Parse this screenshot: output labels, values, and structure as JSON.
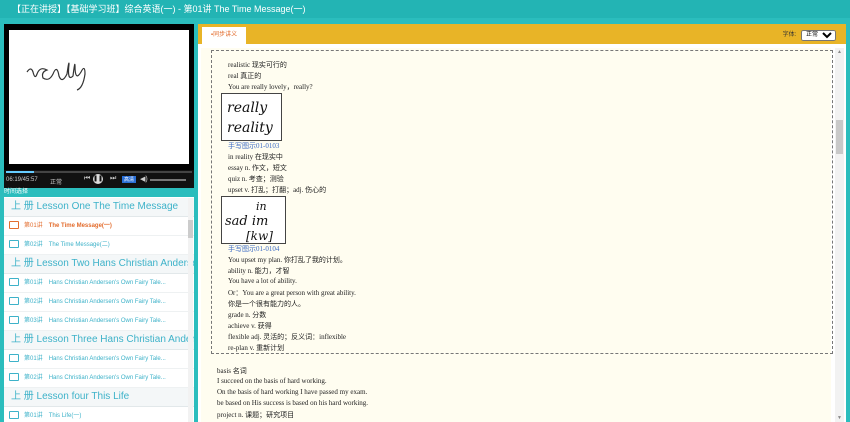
{
  "window": {
    "title": "【正在讲授】【基础学习班】综合英语(一) - 第01讲   The Time Message(一)"
  },
  "player": {
    "handwriting": "really",
    "time": "06:19/45:57",
    "rate": "正常",
    "hd_label": "高清",
    "time_select": "时间选择"
  },
  "lessons": [
    {
      "kind": "head",
      "label": "上   册 Lesson One The Time Message"
    },
    {
      "kind": "item",
      "num": "第01讲",
      "name": "The Time Message(一)",
      "active": true
    },
    {
      "kind": "item",
      "num": "第02讲",
      "name": "The Time Message(二)"
    },
    {
      "kind": "head",
      "label": "上   册 Lesson Two    Hans Christian Andersen"
    },
    {
      "kind": "item",
      "num": "第01讲",
      "name": "Hans Christian Andersen's Own Fairy Tale..."
    },
    {
      "kind": "item",
      "num": "第02讲",
      "name": "Hans Christian Andersen's Own Fairy Tale..."
    },
    {
      "kind": "item",
      "num": "第03讲",
      "name": "Hans Christian Andersen's Own Fairy Tale..."
    },
    {
      "kind": "head",
      "label": "上   册 Lesson Three    Hans Christian Andersen"
    },
    {
      "kind": "item",
      "num": "第01讲",
      "name": "Hans Christian Andersen's Own Fairy Tale..."
    },
    {
      "kind": "item",
      "num": "第02讲",
      "name": "Hans Christian Andersen's Own Fairy Tale..."
    },
    {
      "kind": "head",
      "label": "上   册 Lesson four    This Life"
    },
    {
      "kind": "item",
      "num": "第01讲",
      "name": "This Life(一)"
    }
  ],
  "notes": {
    "tab_label": "同步讲义",
    "font_label": "字体:",
    "font_value": "正常",
    "box_lines_a": [
      "realistic 现实可行的",
      "real 真正的",
      "You are really lovely，really?"
    ],
    "caption1": "手写图示01-0103",
    "box_lines_b": [
      "in reality 在现实中",
      "essay n. 作文，短文",
      "quiz n. 考查；测验",
      "upset v. 打乱；打翻；adj. 伤心的"
    ],
    "caption2": "手写图示01-0104",
    "box_lines_c": [
      "You upset my plan. 你打乱了我的计划。",
      "ability n. 能力，才智",
      "You have a lot of ability.",
      "Or：You are a great person with great ability.",
      "你是一个很有能力的人。",
      "grade n. 分数",
      "achieve v. 获得",
      "flexible adj. 灵活的；反义词：inflexible",
      "re-plan v. 重新计划"
    ],
    "lines_d": [
      "basis 名词",
      "  I succeed on the basis of hard working.",
      "On the basis of hard working I have passed my exam.",
      "be based on His success is based on his hard working.",
      "project n. 课题；研究项目"
    ]
  }
}
